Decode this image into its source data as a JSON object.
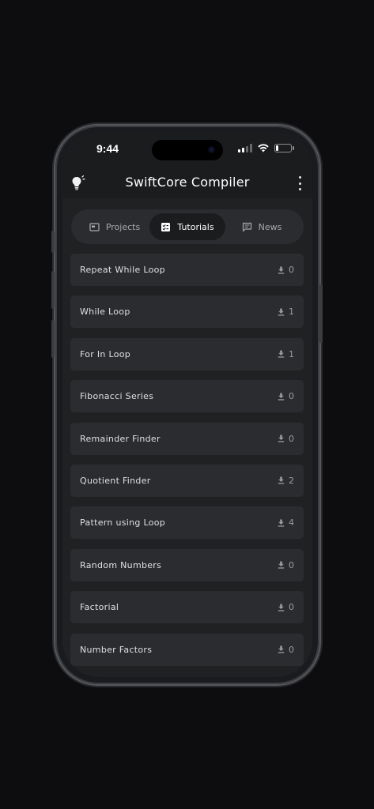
{
  "status_bar": {
    "time": "9:44"
  },
  "app": {
    "title": "SwiftCore Compiler"
  },
  "tabs": [
    {
      "label": "Projects",
      "icon": "window-icon",
      "active": false
    },
    {
      "label": "Tutorials",
      "icon": "checklist-icon",
      "active": true
    },
    {
      "label": "News",
      "icon": "chat-bubble-icon",
      "active": false
    }
  ],
  "tutorials": [
    {
      "title": "Repeat While Loop",
      "downloads": "0"
    },
    {
      "title": "While Loop",
      "downloads": "1"
    },
    {
      "title": "For In Loop",
      "downloads": "1"
    },
    {
      "title": "Fibonacci Series",
      "downloads": "0"
    },
    {
      "title": "Remainder Finder",
      "downloads": "0"
    },
    {
      "title": "Quotient Finder",
      "downloads": "2"
    },
    {
      "title": "Pattern using Loop",
      "downloads": "4"
    },
    {
      "title": "Random Numbers",
      "downloads": "0"
    },
    {
      "title": "Factorial",
      "downloads": "0"
    },
    {
      "title": "Number Factors",
      "downloads": "0"
    }
  ],
  "colors": {
    "background": "#0d0d10",
    "surface": "#202123",
    "card": "#2a2c2f",
    "active_tab": "#1b1c1e"
  }
}
